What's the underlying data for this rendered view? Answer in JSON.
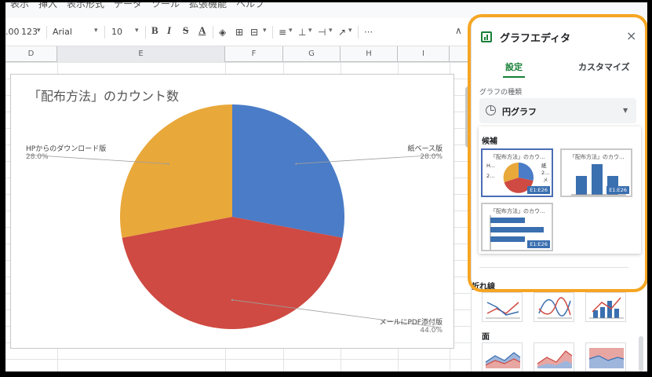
{
  "colors": {
    "blue": "#4a7cc7",
    "red": "#cf4a42",
    "yellow": "#e9a83a",
    "accent_green": "#188038",
    "highlight": "#f5a623",
    "thumb_blue": "#3a6fb0"
  },
  "menu": {
    "text": "表示　挿入　表示形式　データ　ツール　拡張機能　ヘルプ"
  },
  "toolbar": {
    "decimals": ".00",
    "format": "123",
    "font": "Arial",
    "size": "10",
    "bold": "B",
    "italic": "I",
    "strike": "S",
    "textcolor": "A",
    "more": "⋯",
    "collapse": "∧"
  },
  "sheet": {
    "columns": [
      "D",
      "E",
      "F",
      "G",
      "H",
      "I"
    ]
  },
  "chart": {
    "title": "「配布方法」のカウント数",
    "labels": [
      {
        "name": "HPからのダウンロード版",
        "pct": "28.0%"
      },
      {
        "name": "紙ベース版",
        "pct": "28.0%"
      },
      {
        "name": "メールにPDF添付版",
        "pct": "44.0%"
      }
    ]
  },
  "chart_data": {
    "type": "pie",
    "title": "「配布方法」のカウント数",
    "slices": [
      {
        "label": "紙ベース版",
        "value": 28.0,
        "color": "#4a7cc7"
      },
      {
        "label": "メールにPDF添付版",
        "value": 44.0,
        "color": "#cf4a42"
      },
      {
        "label": "HPからのダウンロード版",
        "value": 28.0,
        "color": "#e9a83a"
      }
    ]
  },
  "editor": {
    "title": "グラフエディタ",
    "close": "×",
    "tabs": [
      {
        "label": "設定"
      },
      {
        "label": "カスタマイズ"
      }
    ],
    "chart_type_label": "グラフの種類",
    "chart_type_value": "円グラフ",
    "suggestions_label": "候補",
    "suggestions": [
      {
        "title": "「配布方法」のカウ...",
        "range": "E1:E26",
        "snip_h": "H...",
        "snip_2a": "2...",
        "snip_k": "紙",
        "snip_2b": "2...",
        "snip_m": "メ"
      },
      {
        "title": "「配布方法」のカウ...",
        "range": "E1:E26"
      },
      {
        "title": "「配布方法」のカウ...",
        "range": "E1:E26"
      }
    ],
    "line_label": "折れ線",
    "area_label": "面"
  }
}
